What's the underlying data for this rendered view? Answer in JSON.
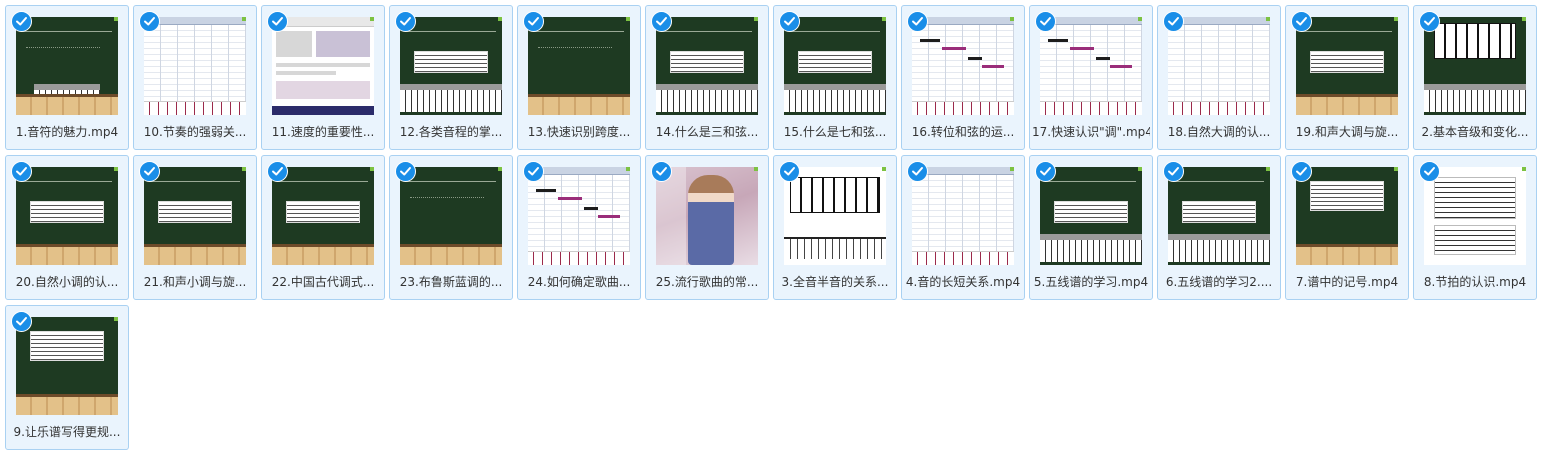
{
  "files": [
    {
      "label": "1.音符的魅力.mp4",
      "thumb": "board-piano",
      "selected": true
    },
    {
      "label": "10.节奏的强弱关...",
      "thumb": "daw",
      "selected": true
    },
    {
      "label": "11.速度的重要性...",
      "thumb": "web",
      "selected": true
    },
    {
      "label": "12.各类音程的掌...",
      "thumb": "board-staff-piano",
      "selected": true
    },
    {
      "label": "13.快速识别跨度...",
      "thumb": "board-text",
      "selected": true
    },
    {
      "label": "14.什么是三和弦...",
      "thumb": "board-staff-piano",
      "selected": true
    },
    {
      "label": "15.什么是七和弦...",
      "thumb": "board-staff-piano",
      "selected": true
    },
    {
      "label": "16.转位和弦的运...",
      "thumb": "daw-notes",
      "selected": true
    },
    {
      "label": "17.快速认识\"调\".mp4",
      "thumb": "daw-notes",
      "selected": true
    },
    {
      "label": "18.自然大调的认...",
      "thumb": "daw",
      "selected": true
    },
    {
      "label": "19.和声大调与旋...",
      "thumb": "board-staff",
      "selected": true
    },
    {
      "label": "2.基本音级和变化...",
      "thumb": "board-keys",
      "selected": true
    },
    {
      "label": "20.自然小调的认...",
      "thumb": "board-staff",
      "selected": true
    },
    {
      "label": "21.和声小调与旋...",
      "thumb": "board-staff",
      "selected": true
    },
    {
      "label": "22.中国古代调式...",
      "thumb": "board-staff",
      "selected": true
    },
    {
      "label": "23.布鲁斯蓝调的...",
      "thumb": "board-text",
      "selected": true
    },
    {
      "label": "24.如何确定歌曲...",
      "thumb": "daw-notes",
      "selected": true
    },
    {
      "label": "25.流行歌曲的常...",
      "thumb": "photo",
      "selected": true
    },
    {
      "label": "3.全音半音的关系...",
      "thumb": "keys",
      "selected": true
    },
    {
      "label": "4.音的长短关系.mp4",
      "thumb": "daw",
      "selected": true
    },
    {
      "label": "5.五线谱的学习.mp4",
      "thumb": "board-staff-piano",
      "selected": true
    },
    {
      "label": "6.五线谱的学习2....",
      "thumb": "board-staff-piano",
      "selected": true
    },
    {
      "label": "7.谱中的记号.mp4",
      "thumb": "board-sheet",
      "selected": true
    },
    {
      "label": "8.节拍的认识.mp4",
      "thumb": "sheet",
      "selected": true
    },
    {
      "label": "9.让乐谱写得更规...",
      "thumb": "board-sheet",
      "selected": true
    }
  ],
  "colors": {
    "accent": "#1a8ee8",
    "tile_bg": "#eaf4fd",
    "tile_border": "#a9d1f2"
  }
}
